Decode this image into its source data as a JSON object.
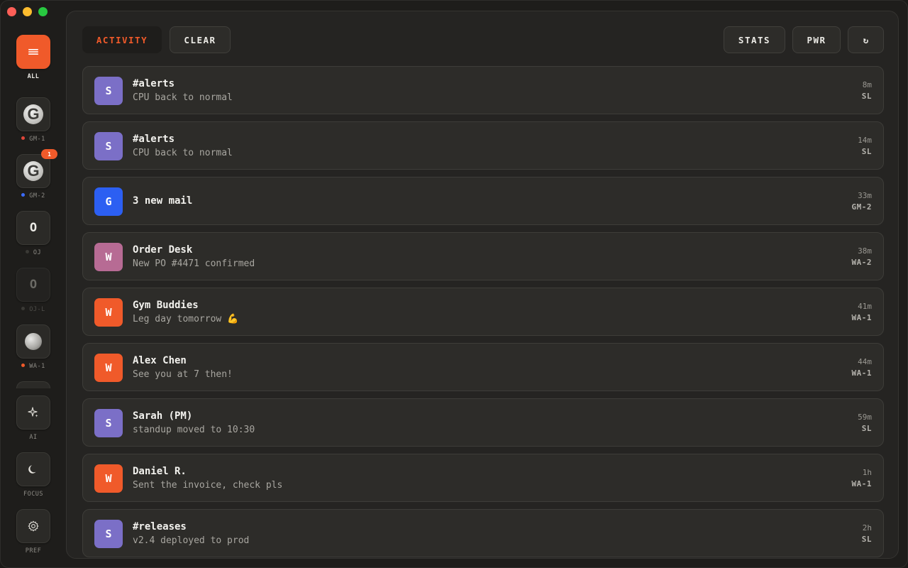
{
  "sidebar": {
    "all": {
      "label": "ALL"
    },
    "accounts": [
      {
        "label": "GM-1",
        "dot_color": "#e0463a",
        "glyph": "G"
      },
      {
        "label": "GM-2",
        "dot_color": "#3b6bff",
        "glyph": "G",
        "badge": "1"
      },
      {
        "label": "OJ",
        "dot_color": "#3a3935",
        "glyph": "O"
      },
      {
        "label": "OJ-L",
        "dot_color": "#3a3935",
        "glyph": "O"
      },
      {
        "label": "WA-1",
        "dot_color": "#f05a2a"
      }
    ],
    "ai": {
      "label": "AI"
    },
    "focus": {
      "label": "FOCUS"
    },
    "pref": {
      "label": "PREF"
    }
  },
  "toolbar": {
    "activity_label": "ACTIVITY",
    "clear_label": "CLEAR",
    "stats_label": "STATS",
    "pwr_label": "PWR",
    "refresh_label": "↻"
  },
  "feed": [
    {
      "avatar": "S",
      "avatar_color": "#7b6fc7",
      "title": "#alerts",
      "subtitle": "CPU back to normal",
      "time": "8m",
      "source": "SL"
    },
    {
      "avatar": "S",
      "avatar_color": "#7b6fc7",
      "title": "#alerts",
      "subtitle": "CPU back to normal",
      "time": "14m",
      "source": "SL"
    },
    {
      "avatar": "G",
      "avatar_color": "#2c5ff2",
      "title": "3 new mail",
      "subtitle": "",
      "time": "33m",
      "source": "GM-2"
    },
    {
      "avatar": "W",
      "avatar_color": "#b76b94",
      "title": "Order Desk",
      "subtitle": "New PO #4471 confirmed",
      "time": "38m",
      "source": "WA-2"
    },
    {
      "avatar": "W",
      "avatar_color": "#f05a2a",
      "title": "Gym Buddies",
      "subtitle": "Leg day tomorrow 💪",
      "time": "41m",
      "source": "WA-1"
    },
    {
      "avatar": "W",
      "avatar_color": "#f05a2a",
      "title": "Alex Chen",
      "subtitle": "See you at 7 then!",
      "time": "44m",
      "source": "WA-1"
    },
    {
      "avatar": "S",
      "avatar_color": "#7b6fc7",
      "title": "Sarah (PM)",
      "subtitle": "standup moved to 10:30",
      "time": "59m",
      "source": "SL"
    },
    {
      "avatar": "W",
      "avatar_color": "#f05a2a",
      "title": "Daniel R.",
      "subtitle": "Sent the invoice, check pls",
      "time": "1h",
      "source": "WA-1"
    },
    {
      "avatar": "S",
      "avatar_color": "#7b6fc7",
      "title": "#releases",
      "subtitle": "v2.4 deployed to prod",
      "time": "2h",
      "source": "SL"
    }
  ]
}
